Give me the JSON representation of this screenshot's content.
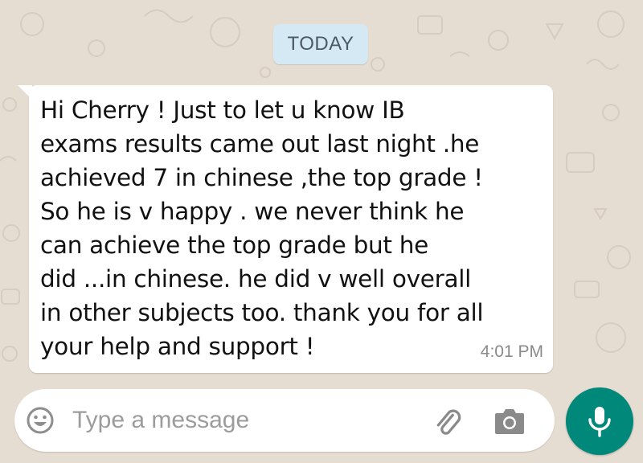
{
  "chat": {
    "date_separator": "TODAY",
    "message": {
      "text": "Hi Cherry ! Just to let u know IB\nexams results came out last night .he\nachieved 7 in chinese ,the top grade !\nSo he is v happy . we never think he\ncan achieve the top grade but he\ndid ...in chinese.  he did v well overall\nin other subjects too. thank you for all\nyour help and support !",
      "time": "4:01 PM"
    }
  },
  "composer": {
    "placeholder": "Type a message",
    "value": ""
  },
  "icons": {
    "emoji": "emoji-icon",
    "attach": "paperclip-icon",
    "camera": "camera-icon",
    "mic": "microphone-icon"
  },
  "colors": {
    "wallpaper": "#e6ddd2",
    "bubble": "#ffffff",
    "date_chip": "#d4e9f4",
    "mic_button": "#00897b"
  }
}
